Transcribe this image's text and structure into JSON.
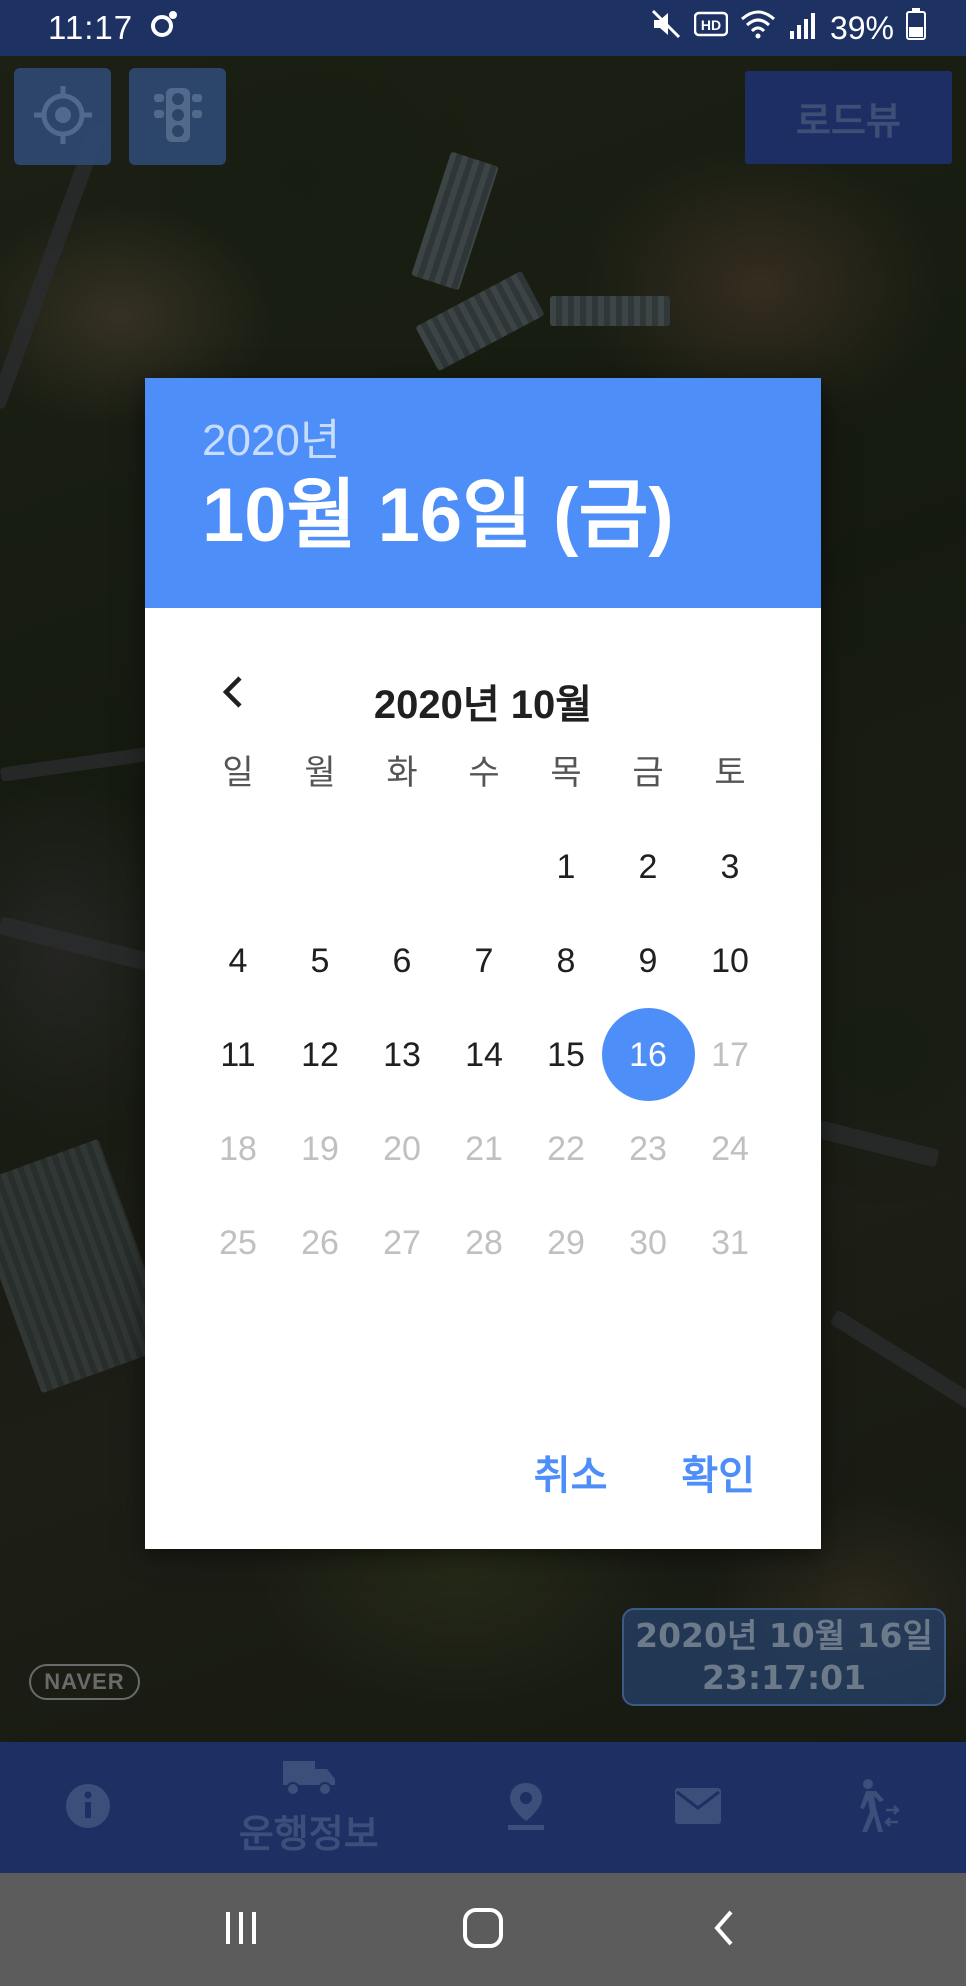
{
  "status_bar": {
    "time": "11:17",
    "battery": "39%"
  },
  "map": {
    "roadview_label": "로드뷰",
    "naver_logo": "NAVER"
  },
  "timestamp": {
    "date": "2020년 10월 16일",
    "time": "23:17:01"
  },
  "bottom_nav": {
    "items": [
      {
        "icon": "info-icon",
        "label": ""
      },
      {
        "icon": "truck-icon",
        "label": "운행정보"
      },
      {
        "icon": "location-pin-icon",
        "label": ""
      },
      {
        "icon": "mail-icon",
        "label": ""
      },
      {
        "icon": "walking-person-icon",
        "label": ""
      }
    ]
  },
  "dialog": {
    "year": "2020년",
    "selected_date": "10월 16일 (금)",
    "month_title": "2020년 10월",
    "weekdays": [
      "일",
      "월",
      "화",
      "수",
      "목",
      "금",
      "토"
    ],
    "weeks": [
      [
        "",
        "",
        "",
        "",
        "1",
        "2",
        "3"
      ],
      [
        "4",
        "5",
        "6",
        "7",
        "8",
        "9",
        "10"
      ],
      [
        "11",
        "12",
        "13",
        "14",
        "15",
        "16",
        "17"
      ],
      [
        "18",
        "19",
        "20",
        "21",
        "22",
        "23",
        "24"
      ],
      [
        "25",
        "26",
        "27",
        "28",
        "29",
        "30",
        "31"
      ]
    ],
    "selected_day": "16",
    "max_enabled_day": 16,
    "cancel_label": "취소",
    "ok_label": "확인",
    "accent_color": "#4d8ef9"
  }
}
